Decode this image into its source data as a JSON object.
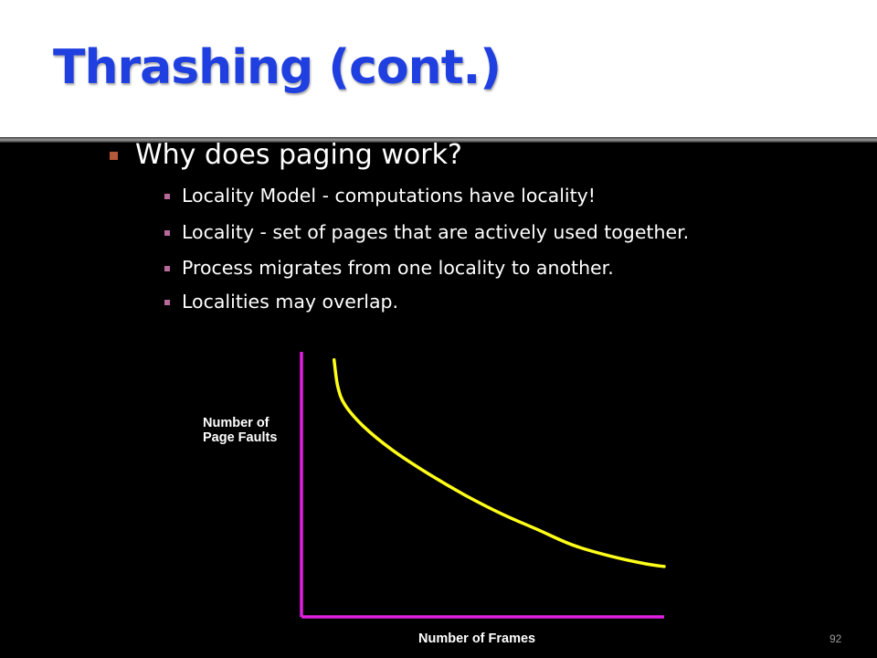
{
  "slide": {
    "title": "Thrashing (cont.)",
    "slide_number": "92",
    "colors": {
      "title": "#1f3fe0",
      "background": "#000000",
      "title_band": "#ffffff",
      "bullet_marker_level1": "#b4583a",
      "bullet_marker_level2": "#b8699a"
    }
  },
  "bullets": {
    "main": "Why does paging work?",
    "sub": [
      "Locality Model - computations have locality!",
      "Locality - set of pages that are actively used together.",
      "Process migrates from one locality to another.",
      "Localities may overlap."
    ]
  },
  "chart_data": {
    "type": "line",
    "title": "",
    "xlabel": "Number of Frames",
    "ylabel": [
      "Number of",
      "Page Faults"
    ],
    "ticks": false,
    "grid": false,
    "legend": "none",
    "colors": {
      "axes": "#e020e0",
      "curve": "#ffff1a"
    },
    "xlim": [
      0,
      100
    ],
    "ylim": [
      0,
      100
    ],
    "series": [
      {
        "x": [
          9,
          10,
          12,
          17,
          25,
          35,
          45,
          55,
          65,
          75,
          85,
          95,
          100
        ],
        "y": [
          97,
          87,
          80,
          72,
          63,
          54,
          46,
          39,
          33,
          27,
          23,
          20,
          19
        ]
      }
    ]
  }
}
